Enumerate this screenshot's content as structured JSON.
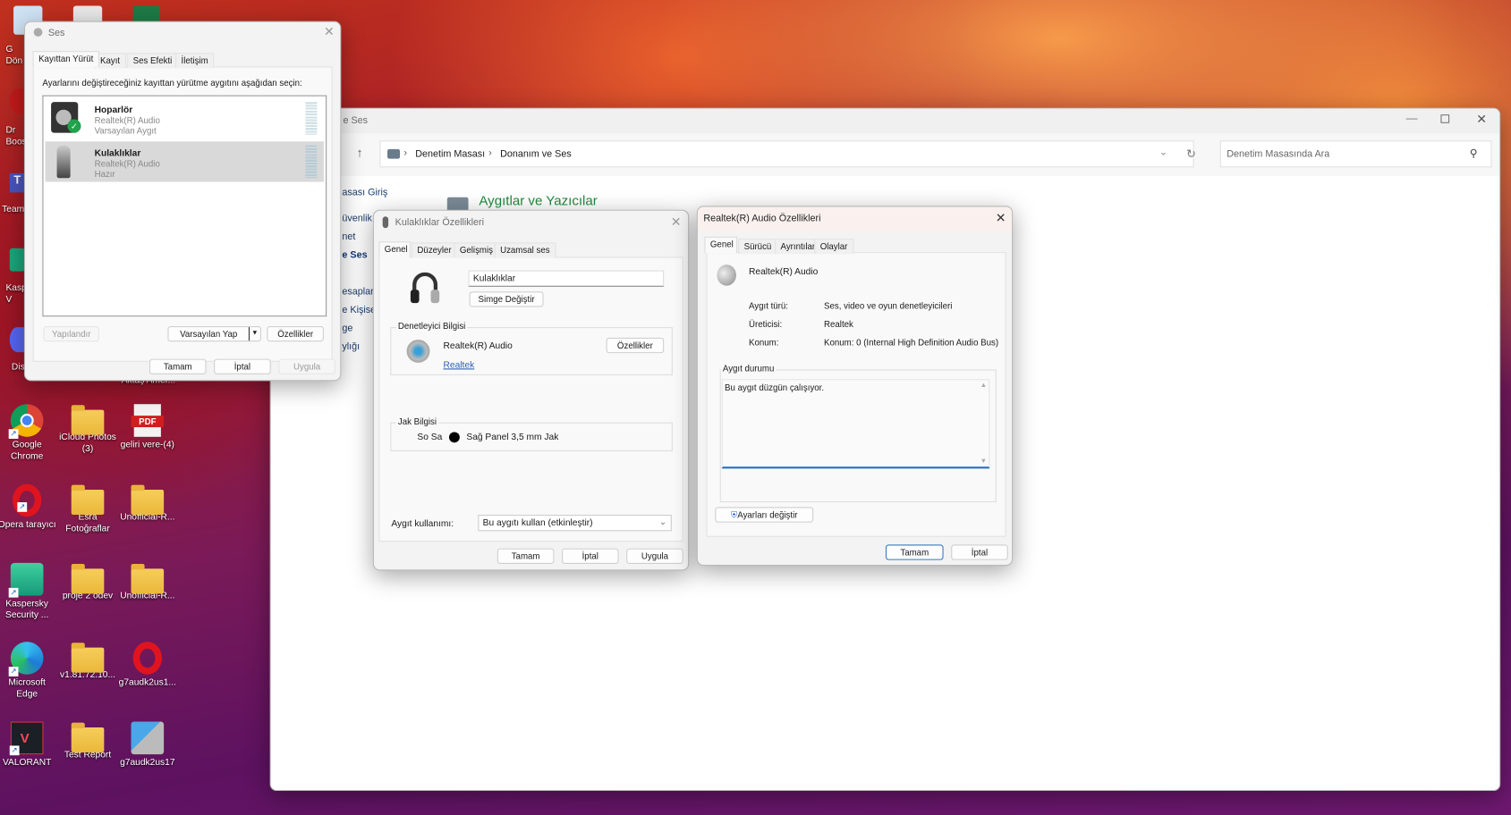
{
  "desktop": {
    "partial_icons": [
      "G",
      "Dön",
      "Dr",
      "Boos",
      "Team",
      "Kasp",
      "V",
      "Dis",
      "Aktaş Amer..."
    ],
    "icons": [
      {
        "label": "Google Chrome",
        "icon": "chrome-icon"
      },
      {
        "label": "iCloud Photos (3)",
        "icon": "zip-folder-icon"
      },
      {
        "label": "geliri vere-(4)",
        "icon": "pdf-icon",
        "badge": "PDF"
      },
      {
        "label": "Opera tarayıcı",
        "icon": "opera-icon"
      },
      {
        "label": "Esra Fotoğraflar",
        "icon": "folder-icon"
      },
      {
        "label": "Unofficial-R...",
        "icon": "folder-icon"
      },
      {
        "label": "Kaspersky Security ...",
        "icon": "kaspersky-icon"
      },
      {
        "label": "proje 2 ödev",
        "icon": "folder-icon"
      },
      {
        "label": "Unofficial-R...",
        "icon": "zip-folder-icon"
      },
      {
        "label": "Microsoft Edge",
        "icon": "edge-icon"
      },
      {
        "label": "v1.81.72.10...",
        "icon": "zip-folder-icon"
      },
      {
        "label": "g7audk2us1...",
        "icon": "opera-icon"
      },
      {
        "label": "VALORANT",
        "icon": "valorant-icon"
      },
      {
        "label": "Test Report",
        "icon": "folder-icon"
      },
      {
        "label": "g7audk2us17",
        "icon": "installer-icon"
      }
    ]
  },
  "control_panel": {
    "title": "e Ses",
    "breadcrumb": [
      "Denetim Masası",
      "Donanım ve Ses"
    ],
    "search_placeholder": "Denetim Masasında Ara",
    "nav": [
      "asası Giriş",
      "üvenlik",
      "net",
      "e Ses",
      "esapları",
      "e Kişisel",
      "ge",
      "ylığı"
    ],
    "heading": "Aygıtlar ve Yazıcılar"
  },
  "sound_dialog": {
    "title": "Ses",
    "tabs": [
      "Kayıttan Yürüt",
      "Kayıt",
      "Ses Efekti",
      "İletişim"
    ],
    "instruction": "Ayarlarını değiştireceğiniz kayıttan yürütme aygıtını aşağıdan seçin:",
    "devices": [
      {
        "name": "Hoparlör",
        "driver": "Realtek(R) Audio",
        "status": "Varsayılan Aygıt"
      },
      {
        "name": "Kulaklıklar",
        "driver": "Realtek(R) Audio",
        "status": "Hazır"
      }
    ],
    "configure": "Yapılandır",
    "set_default": "Varsayılan Yap",
    "properties": "Özellikler",
    "ok": "Tamam",
    "cancel": "İptal",
    "apply": "Uygula"
  },
  "headphones_dialog": {
    "title": "Kulaklıklar Özellikleri",
    "tabs": [
      "Genel",
      "Düzeyler",
      "Gelişmiş",
      "Uzamsal ses"
    ],
    "name_value": "Kulaklıklar",
    "change_icon": "Simge Değiştir",
    "controller_group": "Denetleyici Bilgisi",
    "controller_name": "Realtek(R) Audio",
    "controller_link": "Realtek",
    "properties": "Özellikler",
    "jack_group": "Jak Bilgisi",
    "jack_side": "So Sa",
    "jack_desc": "Sağ Panel 3,5 mm Jak",
    "usage_label": "Aygıt kullanımı:",
    "usage_value": "Bu aygıtı kullan (etkinleştir)",
    "ok": "Tamam",
    "cancel": "İptal",
    "apply": "Uygula"
  },
  "realtek_dialog": {
    "title": "Realtek(R) Audio Özellikleri",
    "tabs": [
      "Genel",
      "Sürücü",
      "Ayrıntılar",
      "Olaylar"
    ],
    "device_name": "Realtek(R) Audio",
    "rows": [
      {
        "label": "Aygıt türü:",
        "value": "Ses, video ve oyun denetleyicileri"
      },
      {
        "label": "Üreticisi:",
        "value": "Realtek"
      },
      {
        "label": "Konum:",
        "value": "Konum: 0 (Internal High Definition Audio Bus)"
      }
    ],
    "status_group": "Aygıt durumu",
    "status_text": "Bu aygıt düzgün çalışıyor.",
    "change_settings": "Ayarları değiştir",
    "ok": "Tamam",
    "cancel": "İptal"
  }
}
